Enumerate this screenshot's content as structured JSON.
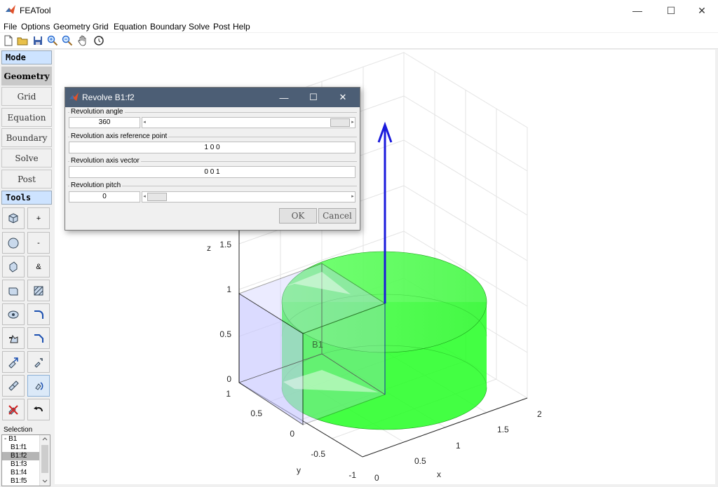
{
  "window": {
    "title": "FEATool",
    "controls": {
      "minimize": "—",
      "maximize": "☐",
      "close": "✕"
    }
  },
  "menu": [
    "File",
    "Options",
    "Geometry",
    "Grid",
    "Equation",
    "Boundary",
    "Solve",
    "Post",
    "Help"
  ],
  "toolbar": {
    "icons": [
      "new-file-icon",
      "open-folder-icon",
      "save-icon",
      "zoom-in-icon",
      "zoom-out-icon",
      "pan-hand-icon",
      "rotate-3d-icon"
    ]
  },
  "sidebar": {
    "mode_header": "Mode",
    "modes": [
      "Geometry",
      "Grid",
      "Equation",
      "Boundary",
      "Solve",
      "Post"
    ],
    "active_mode": "Geometry",
    "tools_header": "Tools",
    "tools": [
      {
        "left_icon": "cube-icon",
        "right_label": "+"
      },
      {
        "left_icon": "sphere-icon",
        "right_label": "-"
      },
      {
        "left_icon": "cylinder-icon",
        "right_label": "&"
      },
      {
        "left_icon": "box-cut-icon",
        "right_icon": "hatch-fill-icon"
      },
      {
        "left_icon": "eye-icon",
        "right_icon": "fillet-curve-icon"
      },
      {
        "left_icon": "extrude-shape-icon",
        "right_icon": "chamfer-curve-icon"
      },
      {
        "left_icon": "move-object-icon",
        "right_icon": "scale-object-icon"
      },
      {
        "left_icon": "copy-object-icon",
        "right_icon": "revolve-object-icon"
      },
      {
        "left_icon": "delete-object-icon",
        "right_icon": "undo-icon"
      }
    ],
    "selection_label": "Selection",
    "selection_items": [
      "- B1",
      "B1:f1",
      "B1:f2",
      "B1:f3",
      "B1:f4",
      "B1:f5"
    ],
    "selected_item": "B1:f2"
  },
  "plot": {
    "axes": {
      "z_label": "z",
      "x_label": "x",
      "y_label": "y",
      "z_ticks": [
        "0",
        "0.5",
        "1",
        "1.5"
      ],
      "x_ticks": [
        "0",
        "0.5",
        "1",
        "1.5",
        "2"
      ],
      "y_ticks": [
        "-1",
        "-0.5",
        "0",
        "0.5",
        "1"
      ]
    },
    "object_label": "B1",
    "colors": {
      "cylinder": "#00ff00",
      "arrow": "#1a1adc",
      "box": "#c8c8ff"
    }
  },
  "dialog": {
    "title": "Revolve B1:f2",
    "controls": {
      "minimize": "—",
      "maximize": "☐",
      "close": "✕"
    },
    "angle_label": "Revolution angle",
    "angle_value": "360",
    "angle_slider_fraction": 1.0,
    "ref_point_label": "Revolution axis reference point",
    "ref_point_value": "1  0  0",
    "axis_vector_label": "Revolution axis vector",
    "axis_vector_value": "0  0  1",
    "pitch_label": "Revolution pitch",
    "pitch_value": "0",
    "pitch_slider_fraction": 0.0,
    "ok_label": "OK",
    "cancel_label": "Cancel"
  }
}
